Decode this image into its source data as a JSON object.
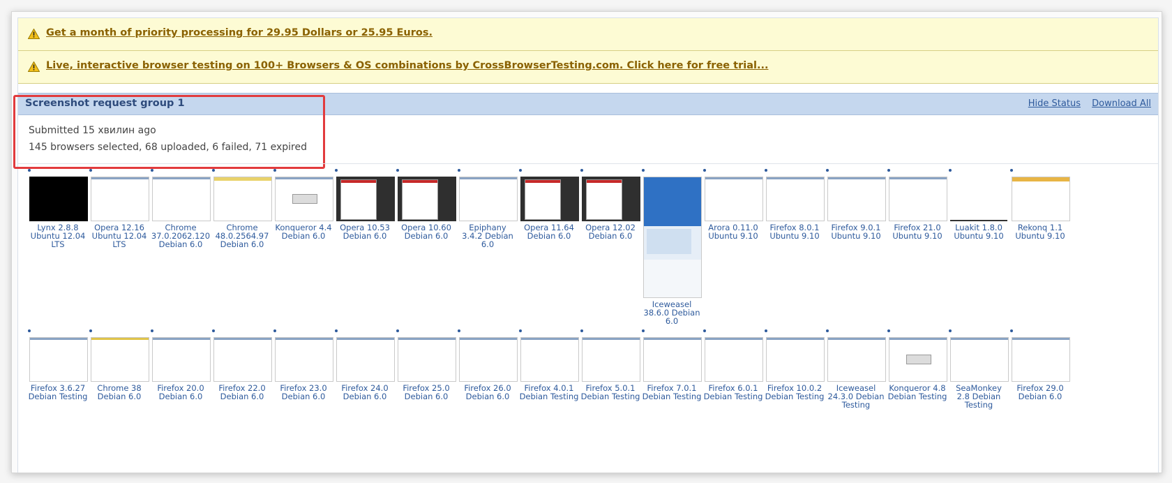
{
  "notices": [
    {
      "text": "Get a month of priority processing for 29.95 Dollars or 25.95 Euros.",
      "icon": "warning-icon"
    },
    {
      "text": "Live, interactive browser testing on 100+ Browsers & OS combinations by CrossBrowserTesting.com. Click here for free trial...",
      "icon": "warning-icon"
    }
  ],
  "group": {
    "title": "Screenshot request group 1",
    "hide_status": "Hide Status",
    "download_all": "Download All",
    "submitted": "Submitted 15 хвилин ago",
    "summary": "145 browsers selected, 68 uploaded, 6 failed, 71 expired"
  },
  "row1": [
    {
      "label": "Lynx 2.8.8 Ubuntu 12.04 LTS",
      "style": "black"
    },
    {
      "label": "Opera 12.16 Ubuntu 12.04 LTS",
      "style": "plain"
    },
    {
      "label": "Chrome 37.0.2062.120 Debian 6.0",
      "style": "plain"
    },
    {
      "label": "Chrome 48.0.2564.97 Debian 6.0",
      "style": "yellow"
    },
    {
      "label": "Konqueror 4.4 Debian 6.0",
      "style": "konq"
    },
    {
      "label": "Opera 10.53 Debian 6.0",
      "style": "dark"
    },
    {
      "label": "Opera 10.60 Debian 6.0",
      "style": "dark"
    },
    {
      "label": "Epiphany 3.4.2 Debian 6.0",
      "style": "plain"
    },
    {
      "label": "Opera 11.64 Debian 6.0",
      "style": "dark"
    },
    {
      "label": "Opera 12.02 Debian 6.0",
      "style": "dark"
    },
    {
      "label": "Iceweasel 38.6.0 Debian 6.0",
      "style": "tall"
    },
    {
      "label": "Arora 0.11.0 Ubuntu 9.10",
      "style": "plain"
    },
    {
      "label": "Firefox 8.0.1 Ubuntu 9.10",
      "style": "plain"
    },
    {
      "label": "Firefox 9.0.1 Ubuntu 9.10",
      "style": "plain"
    },
    {
      "label": "Firefox 21.0 Ubuntu 9.10",
      "style": "plain"
    },
    {
      "label": "Luakit 1.8.0 Ubuntu 9.10",
      "style": "luakit"
    },
    {
      "label": "Rekonq 1.1 Ubuntu 9.10",
      "style": "rekonq"
    }
  ],
  "row2": [
    {
      "label": "Firefox 3.6.27 Debian Testing",
      "style": "plain"
    },
    {
      "label": "Chrome 38 Debian 6.0",
      "style": "chrome38"
    },
    {
      "label": "Firefox 20.0 Debian 6.0",
      "style": "plain"
    },
    {
      "label": "Firefox 22.0 Debian 6.0",
      "style": "plain"
    },
    {
      "label": "Firefox 23.0 Debian 6.0",
      "style": "plain"
    },
    {
      "label": "Firefox 24.0 Debian 6.0",
      "style": "plain"
    },
    {
      "label": "Firefox 25.0 Debian 6.0",
      "style": "plain"
    },
    {
      "label": "Firefox 26.0 Debian 6.0",
      "style": "plain"
    },
    {
      "label": "Firefox 4.0.1 Debian Testing",
      "style": "plain"
    },
    {
      "label": "Firefox 5.0.1 Debian Testing",
      "style": "plain"
    },
    {
      "label": "Firefox 7.0.1 Debian Testing",
      "style": "plain"
    },
    {
      "label": "Firefox 6.0.1 Debian Testing",
      "style": "plain"
    },
    {
      "label": "Firefox 10.0.2 Debian Testing",
      "style": "plain"
    },
    {
      "label": "Iceweasel 24.3.0 Debian Testing",
      "style": "plain"
    },
    {
      "label": "Konqueror 4.8 Debian Testing",
      "style": "konq"
    },
    {
      "label": "SeaMonkey 2.8 Debian Testing",
      "style": "plain"
    },
    {
      "label": "Firefox 29.0 Debian 6.0",
      "style": "plain"
    }
  ]
}
